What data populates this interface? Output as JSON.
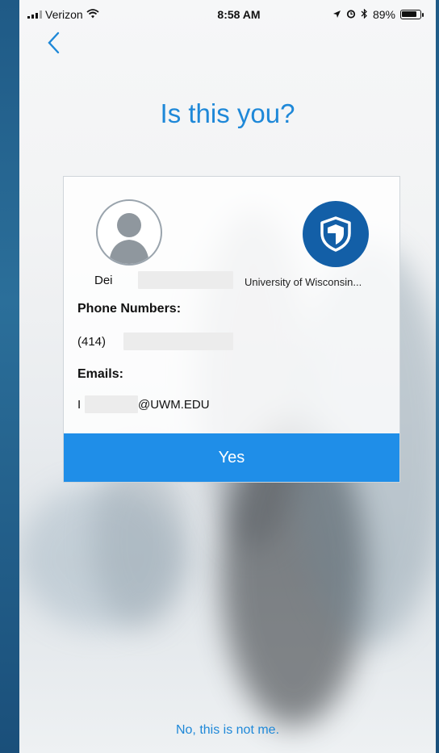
{
  "status_bar": {
    "carrier": "Verizon",
    "time": "8:58 AM",
    "battery_percent": "89%",
    "battery_level": 0.89
  },
  "header": {
    "back_icon": "chevron-left-icon"
  },
  "title": "Is this you?",
  "card": {
    "name_visible": "Dei",
    "organization": "University of Wisconsin...",
    "phone_label": "Phone Numbers:",
    "phone_value": "(414)",
    "email_label": "Emails:",
    "email_prefix": "I",
    "email_domain": "@UWM.EDU",
    "yes_label": "Yes"
  },
  "footer": {
    "not_me_label": "No, this is not me."
  },
  "colors": {
    "accent": "#1e88d8",
    "button": "#1f8ee8",
    "logo": "#135fa7"
  }
}
